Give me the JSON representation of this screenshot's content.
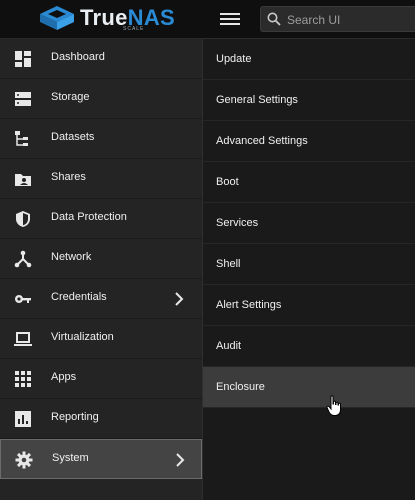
{
  "header": {
    "logo_text_true": "True",
    "logo_text_nas": "NAS",
    "logo_sub": "SCALE",
    "search_placeholder": "Search UI"
  },
  "sidebar": {
    "items": [
      {
        "label": "Dashboard",
        "icon": "dashboard-icon"
      },
      {
        "label": "Storage",
        "icon": "storage-icon"
      },
      {
        "label": "Datasets",
        "icon": "datasets-icon"
      },
      {
        "label": "Shares",
        "icon": "shares-icon"
      },
      {
        "label": "Data Protection",
        "icon": "shield-icon"
      },
      {
        "label": "Network",
        "icon": "network-icon"
      },
      {
        "label": "Credentials",
        "icon": "key-icon"
      },
      {
        "label": "Virtualization",
        "icon": "laptop-icon"
      },
      {
        "label": "Apps",
        "icon": "apps-grid-icon"
      },
      {
        "label": "Reporting",
        "icon": "reporting-icon"
      },
      {
        "label": "System",
        "icon": "gear-icon"
      }
    ],
    "active": "System"
  },
  "submenu": {
    "items": [
      "Update",
      "General Settings",
      "Advanced Settings",
      "Boot",
      "Services",
      "Shell",
      "Alert Settings",
      "Audit",
      "Enclosure"
    ],
    "hovered": "Enclosure"
  },
  "colors": {
    "accent": "#2a8bd4",
    "sidebar_bg": "#242424",
    "active_bg": "#444444"
  }
}
